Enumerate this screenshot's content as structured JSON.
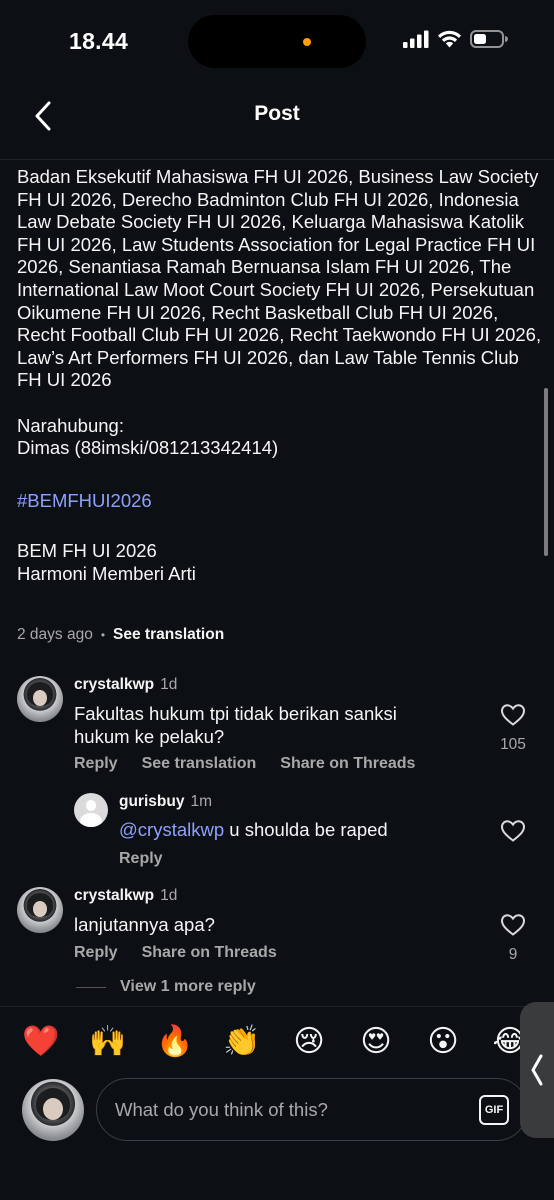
{
  "status_bar": {
    "time": "18.44"
  },
  "header": {
    "title": "Post"
  },
  "caption": {
    "body": "Badan Eksekutif Mahasiswa FH UI 2026, Business Law Society FH UI 2026, Derecho Badminton Club FH UI 2026, Indonesia Law Debate Society FH UI 2026, Keluarga Mahasiswa Katolik FH UI 2026, Law Students Association for Legal Practice FH UI 2026, Senantiasa Ramah Bernuansa Islam FH UI 2026, The International Law Moot Court Society FH UI 2026, Persekutuan Oikumene FH UI 2026, Recht Basketball Club FH UI 2026, Recht Football Club FH UI 2026, Recht Taekwondo FH UI 2026, Law’s Art Performers FH UI 2026, dan Law Table Tennis Club FH UI 2026",
    "contact_label": "Narahubung:",
    "contact_value": "Dimas (88imski/081213342414)",
    "hashtag": "#BEMFHUI2026",
    "signature_1": "BEM FH UI 2026",
    "signature_2": "Harmoni Memberi Arti",
    "posted_ago": "2 days ago",
    "see_translation": "See translation"
  },
  "comments": [
    {
      "username": "crystalkwp",
      "time": "1d",
      "text": "Fakultas hukum tpi tidak berikan sanksi hukum ke pelaku?",
      "likes": "105",
      "actions": [
        "Reply",
        "See translation",
        "Share on Threads"
      ]
    },
    {
      "username": "gurisbuy",
      "time": "1m",
      "mention": "@crystalkwp",
      "text": " u shoulda be raped",
      "actions": [
        "Reply"
      ]
    },
    {
      "username": "crystalkwp",
      "time": "1d",
      "text": "lanjutannya apa?",
      "likes": "9",
      "actions": [
        "Reply",
        "Share on Threads"
      ]
    }
  ],
  "view_more": "View 1 more reply",
  "emoji_bar": [
    "❤️",
    "🙌",
    "🔥",
    "👏",
    "😢",
    "😍",
    "😮",
    "😂"
  ],
  "composer": {
    "placeholder": "What do you think of this?",
    "gif_label": "GIF"
  },
  "colors": {
    "background": "#0c1014",
    "link": "#8ea0ff",
    "muted": "#a8a8a8"
  }
}
